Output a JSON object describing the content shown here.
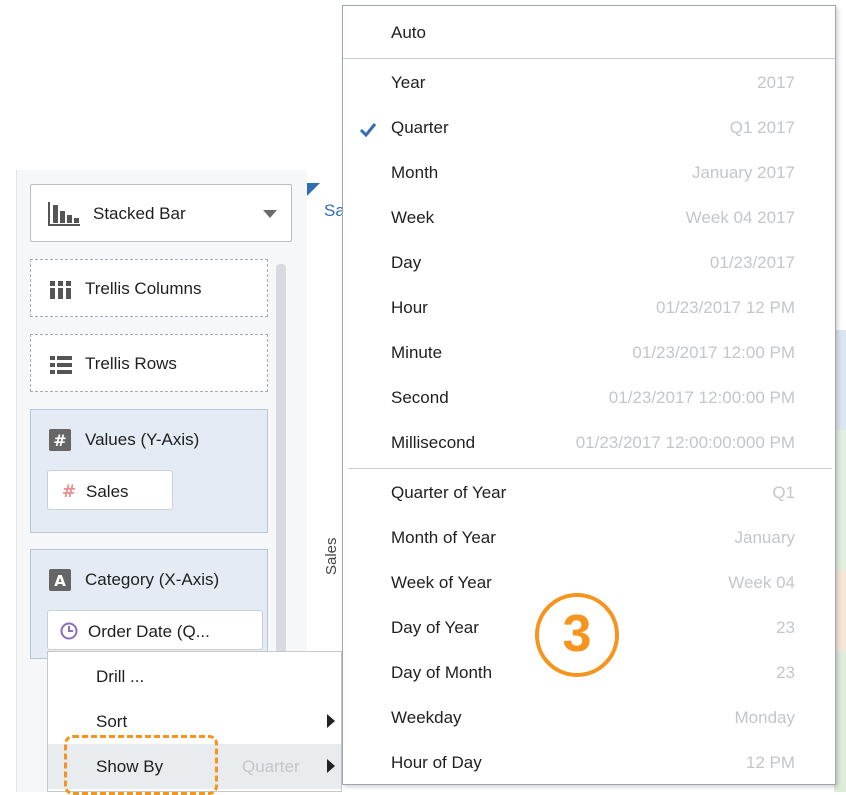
{
  "chart_type_selector": {
    "label": "Stacked Bar"
  },
  "drop_zones": {
    "trellis_columns": "Trellis Columns",
    "trellis_rows": "Trellis Rows"
  },
  "values_axis": {
    "title": "Values (Y-Axis)",
    "pill": "Sales"
  },
  "category_axis": {
    "title": "Category (X-Axis)",
    "pill": "Order Date (Q..."
  },
  "chart": {
    "title_fragment": "Sa",
    "y_axis_label": "Sales"
  },
  "context_menu": {
    "items": [
      {
        "label": "Drill ...",
        "value": "",
        "has_submenu": false
      },
      {
        "label": "Sort",
        "value": "",
        "has_submenu": true
      },
      {
        "label": "Show By",
        "value": "Quarter",
        "has_submenu": true
      }
    ]
  },
  "show_by_menu": {
    "auto": "Auto",
    "items": [
      {
        "label": "Year",
        "value": "2017",
        "checked": false
      },
      {
        "label": "Quarter",
        "value": "Q1 2017",
        "checked": true
      },
      {
        "label": "Month",
        "value": "January 2017",
        "checked": false
      },
      {
        "label": "Week",
        "value": "Week 04 2017",
        "checked": false
      },
      {
        "label": "Day",
        "value": "01/23/2017",
        "checked": false
      },
      {
        "label": "Hour",
        "value": "01/23/2017 12 PM",
        "checked": false
      },
      {
        "label": "Minute",
        "value": "01/23/2017 12:00 PM",
        "checked": false
      },
      {
        "label": "Second",
        "value": "01/23/2017 12:00:00 PM",
        "checked": false
      },
      {
        "label": "Millisecond",
        "value": "01/23/2017 12:00:00:000 PM",
        "checked": false
      }
    ],
    "groups": [
      {
        "label": "Quarter of Year",
        "value": "Q1"
      },
      {
        "label": "Month of Year",
        "value": "January"
      },
      {
        "label": "Week of Year",
        "value": "Week 04"
      },
      {
        "label": "Day of Year",
        "value": "23"
      },
      {
        "label": "Day of Month",
        "value": "23"
      },
      {
        "label": "Weekday",
        "value": "Monday"
      },
      {
        "label": "Hour of Day",
        "value": "12 PM"
      }
    ]
  },
  "callout": {
    "number": "3"
  },
  "colors": {
    "accent": "#f7941d",
    "check": "#2f6db5",
    "muted_value": "#c3c6ca"
  }
}
